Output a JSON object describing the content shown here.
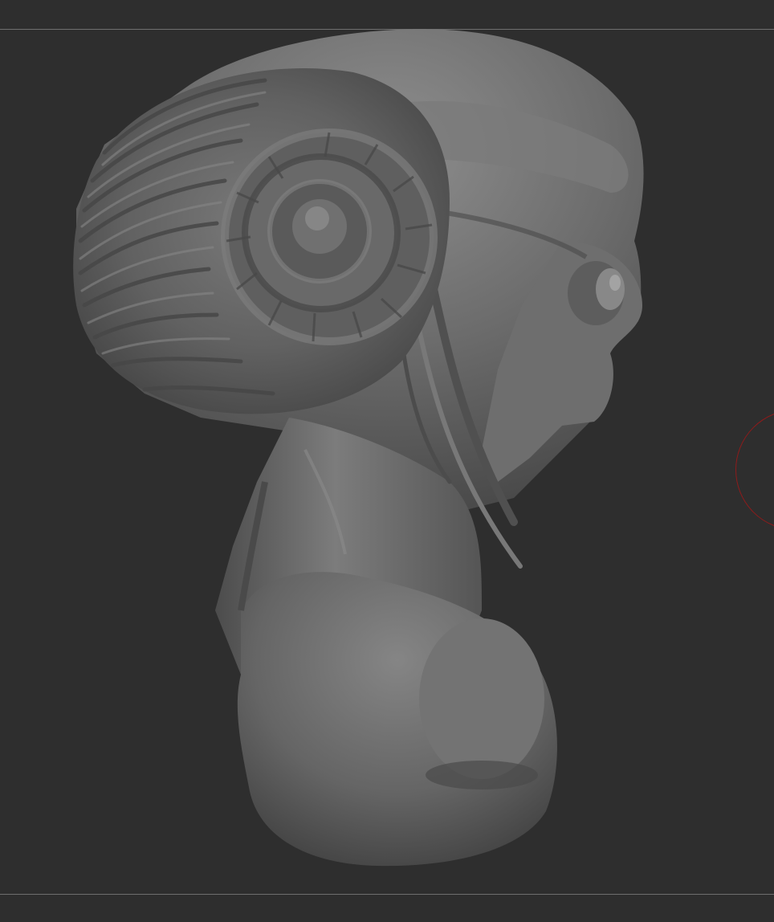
{
  "viewport": {
    "background_color": "#2e2e2e",
    "frame_line_color": "#6f6f6f"
  },
  "model": {
    "subject": "sculpted-creature-bust-with-spiral-ram-horn",
    "material_color": "#6a6a6a",
    "highlight_color": "#8e8e8e",
    "shadow_color": "#3b3b3b"
  },
  "brush_cursor": {
    "color": "#8e1b1b"
  }
}
